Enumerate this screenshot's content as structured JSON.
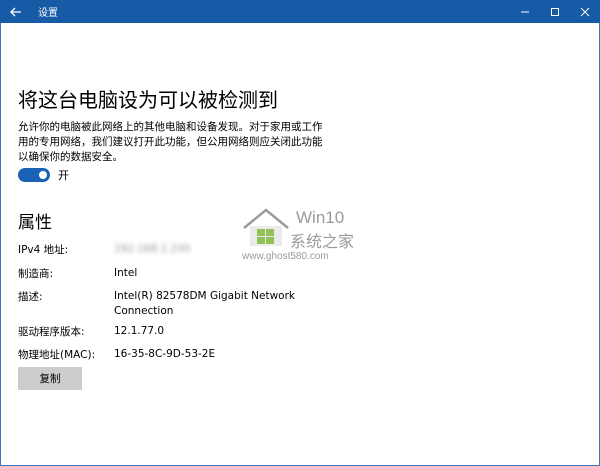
{
  "window": {
    "title": "设置",
    "accent_color": "#175ba6"
  },
  "page": {
    "heading": "将这台电脑设为可以被检测到",
    "description_lines": [
      "允许你的电脑被此网络上的其他电脑和设备发现。对于家用或工作",
      "用的专用网络，我们建议打开此功能，但公用网络则应关闭此功能",
      "以确保你的数据安全。"
    ],
    "toggle": {
      "state_label": "开",
      "on": true
    }
  },
  "properties": {
    "title": "属性",
    "rows": [
      {
        "label": "IPv4 地址:",
        "value": "192.168.1.245"
      },
      {
        "label": "制造商:",
        "value": "Intel"
      },
      {
        "label": "描述:",
        "value": "Intel(R) 82578DM Gigabit Network Connection"
      },
      {
        "label": "驱动程序版本:",
        "value": "12.1.77.0"
      },
      {
        "label": "物理地址(MAC):",
        "value": "16-35-8C-9D-53-2E"
      }
    ],
    "copy_button_label": "复制"
  },
  "watermark": {
    "line1": "Win10",
    "line2": "系统之家",
    "line3": "www.ghost580.com"
  }
}
